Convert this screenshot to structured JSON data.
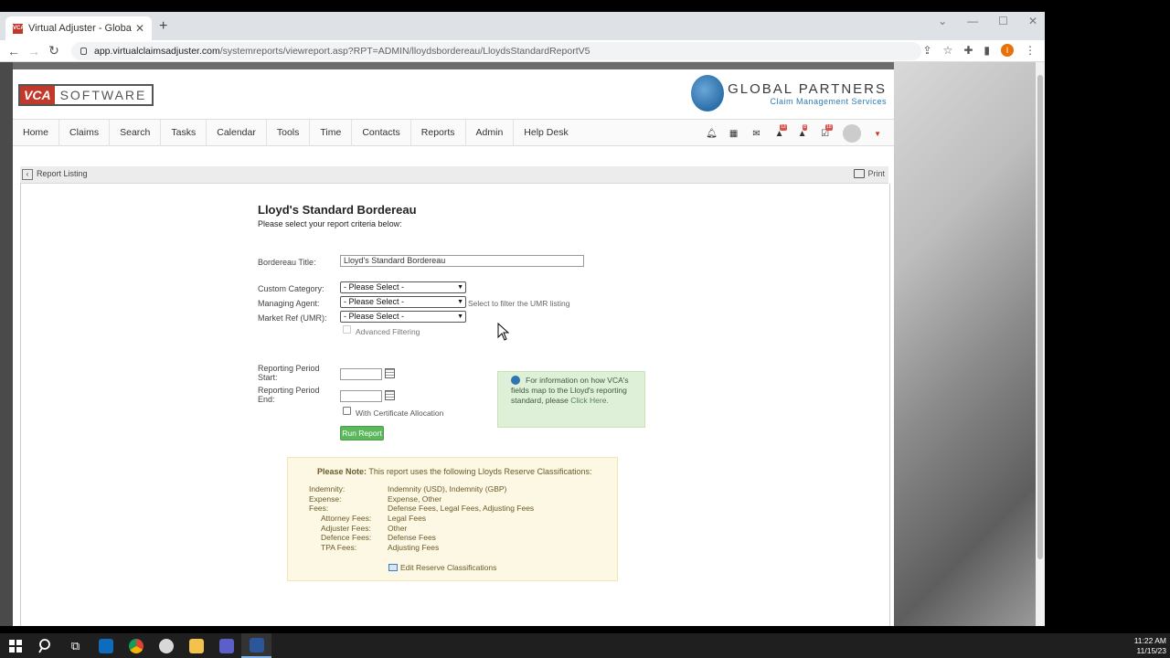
{
  "browser": {
    "tab_title": "Virtual Adjuster - Global Partne",
    "favicon_text": "VCA",
    "url_host": "app.virtualclaimsadjuster.com",
    "url_path": "/systemreports/viewreport.asp?RPT=ADMIN/lloydsbordereau/LloydsStandardReportV5",
    "profile_initial": "I"
  },
  "header": {
    "logo_left_vca": "VCA",
    "logo_left_software": "SOFTWARE",
    "logo_right_name": "GLOBAL PARTNERS",
    "logo_right_tagline": "Claim Management Services"
  },
  "nav": {
    "items": [
      "Home",
      "Claims",
      "Search",
      "Tasks",
      "Calendar",
      "Tools",
      "Time",
      "Contacts",
      "Reports",
      "Admin",
      "Help Desk"
    ],
    "badges": {
      "alerts": "13",
      "warnings": "8",
      "tasks": "18"
    }
  },
  "subbar": {
    "back_label": "Report Listing",
    "print_label": "Print"
  },
  "report": {
    "title": "Lloyd's Standard Bordereau",
    "subtitle": "Please select your report criteria below:",
    "bordereau_title_label": "Bordereau Title:",
    "bordereau_title_value": "Lloyd's Standard Bordereau",
    "custom_category_label": "Custom Category:",
    "custom_category_value": "- Please Select -",
    "managing_agent_label": "Managing Agent:",
    "managing_agent_value": "- Please Select -",
    "managing_agent_hint": "Select to filter the UMR listing",
    "market_ref_label": "Market Ref (UMR):",
    "market_ref_value": "- Please Select -",
    "advanced_filtering_label": "Advanced Filtering",
    "period_start_label_1": "Reporting Period",
    "period_start_label_2": "Start:",
    "period_end_label_1": "Reporting Period",
    "period_end_label_2": "End:",
    "cert_alloc_label": "With Certificate Allocation",
    "run_button": "Run Report"
  },
  "info": {
    "text": "For information on how VCA's fields map to the Lloyd's reporting standard, please",
    "link": "Click Here."
  },
  "note": {
    "heading_bold": "Please Note:",
    "heading_rest": "This report uses the following Lloyds Reserve Classifications:",
    "rows": [
      {
        "label": "Indemnity:",
        "value": "Indemnity (USD), Indemnity (GBP)",
        "indent": false
      },
      {
        "label": "Expense:",
        "value": "Expense, Other",
        "indent": false
      },
      {
        "label": "Fees:",
        "value": "Defense Fees, Legal Fees, Adjusting Fees",
        "indent": false
      },
      {
        "label": "Attorney Fees:",
        "value": "Legal Fees",
        "indent": true
      },
      {
        "label": "Adjuster Fees:",
        "value": "Other",
        "indent": true
      },
      {
        "label": "Defence Fees:",
        "value": "Defense Fees",
        "indent": true
      },
      {
        "label": "TPA Fees:",
        "value": "Adjusting Fees",
        "indent": true
      }
    ],
    "edit_link": "Edit Reserve Classifications"
  },
  "taskbar": {
    "time": "11:22 AM",
    "date": "11/15/23"
  }
}
